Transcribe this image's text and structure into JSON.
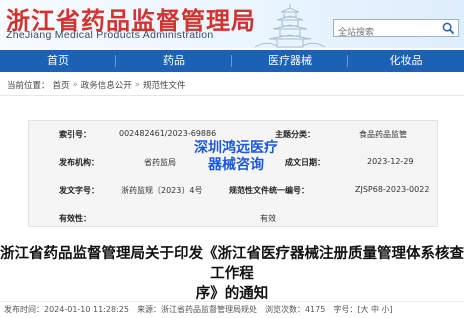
{
  "header": {
    "title": "浙江省药品监督管理局",
    "subtitle": "ZheJiang Medical Products Administration",
    "search_placeholder": "全站搜索",
    "colors": {
      "title": "#d3322d",
      "nav": "#1b61b6"
    }
  },
  "nav": {
    "items": [
      "首页",
      "药品",
      "医疗器械",
      "化妆品"
    ]
  },
  "breadcrumb": {
    "items": [
      "当前位置：",
      "首页",
      "政务信息公开",
      "规范性文件"
    ],
    "separator": "»"
  },
  "info": {
    "index_label": "索引号：",
    "index_value": "002482461/2023-69886",
    "category_label": "主题分类：",
    "category_value": "食品药品监管",
    "publisher_label": "发布机构：",
    "publisher_value": "省药监局",
    "created_label": "成文日期：",
    "created_value": "2023-12-29",
    "doc_no_label": "发文字号：",
    "doc_no_value": "浙药监规〔2023〕4号",
    "reg_no_label": "规范性文件统一编号：",
    "reg_no_value": "ZJSP68-2023-0022",
    "validity_label": "有效性：",
    "validity_value": "有效"
  },
  "watermark": {
    "line1": "深圳鸿远医疗",
    "line2": "器械咨询"
  },
  "article": {
    "title_line1": "浙江省药品监督管理局关于印发《浙江省医疗器械注册质量管理体系核查工作程",
    "title_line2": "序》的通知"
  },
  "meta": {
    "text": "发布时间：2024-01-10 11:28:25　来源：浙江省药品监督管理局规处　浏览次数：4175　字号：[大 中 小]"
  }
}
